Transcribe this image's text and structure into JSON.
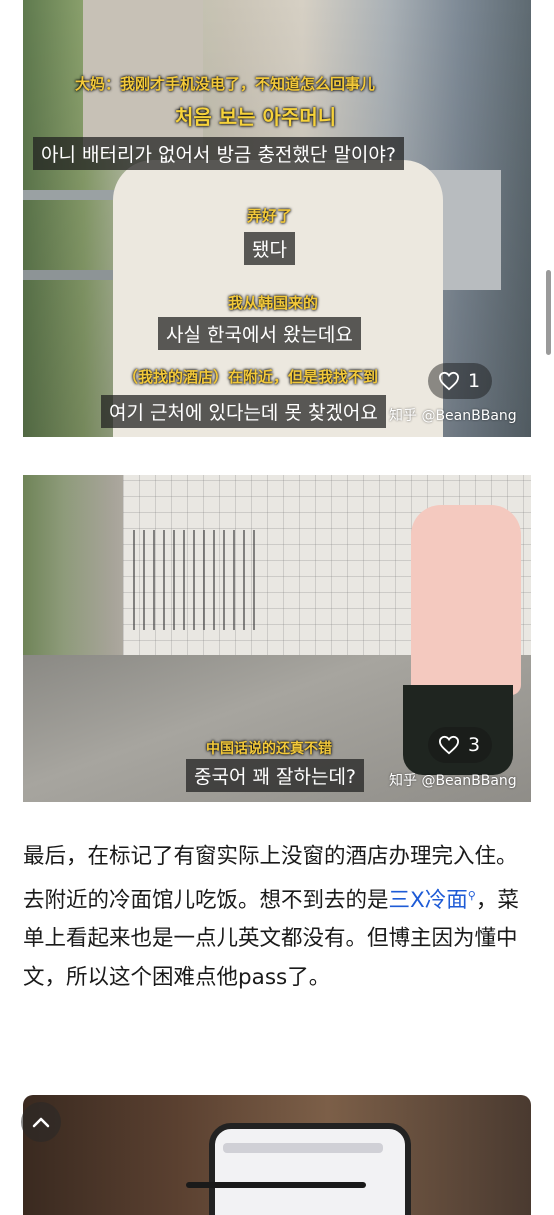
{
  "post": {
    "image1": {
      "subtitles": [
        {
          "cn": "大妈：我刚才手机没电了，不知道怎么回事儿"
        },
        {
          "title": "처음 보는 아주머니"
        },
        {
          "kr": "아니 배터리가 없어서 방금 충전했단 말이야?"
        },
        {
          "cn": "弄好了"
        },
        {
          "kr": "됐다"
        },
        {
          "cn": "我从韩国来的"
        },
        {
          "kr": "사실 한국에서 왔는데요"
        },
        {
          "cn": "（我找的酒店）在附近，但是我找不到"
        },
        {
          "kr": "여기 근처에 있다는데 못 찾겠어요"
        }
      ],
      "likes": "1",
      "watermark": "知乎 @BeanBBang"
    },
    "image2": {
      "subtitle_cn": "中国话说的还真不错",
      "subtitle_kr": "중국어 꽤 잘하는데?",
      "likes": "3",
      "watermark": "知乎 @BeanBBang"
    },
    "paragraph": {
      "part1": "最后，在标记了有窗实际上没窗的酒店办理完入住。去附近的冷面馆儿吃饭。想不到去的是",
      "link": "三X冷面",
      "link_mark": "⚲",
      "part2": "，菜单上看起来也是一点儿英文都没有。但博主因为懂中文，所以这个困难点他pass了。"
    }
  },
  "icons": {
    "like": "heart-outline-icon",
    "back_to_top": "chevron-up-icon",
    "search_mark": "search-icon"
  },
  "colors": {
    "link": "#1e5bd6",
    "subtitle_cn": "#f3c93a",
    "text": "#1a1a1a"
  }
}
